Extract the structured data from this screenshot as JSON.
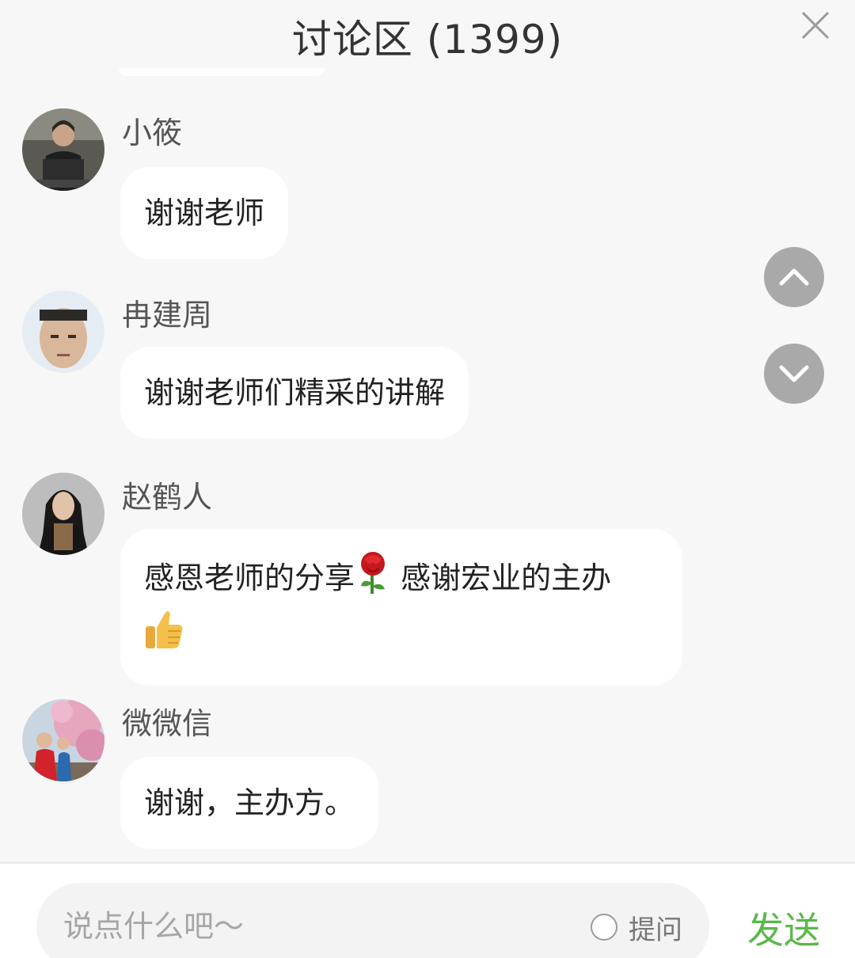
{
  "header": {
    "title": "讨论区 (1399)"
  },
  "messages": [
    {
      "name": "小筱",
      "text": "谢谢老师"
    },
    {
      "name": "冉建周",
      "text": "谢谢老师们精采的讲解"
    },
    {
      "name": "赵鹤人",
      "text_part1": "感恩老师的分享",
      "text_part2": "感谢宏业的主办",
      "emojis": [
        "rose-emoji",
        "thumbs-up-emoji"
      ]
    },
    {
      "name": "微微信",
      "text": "谢谢，主办方。"
    }
  ],
  "input": {
    "placeholder": "说点什么吧～",
    "ask_label": "提问",
    "send_label": "发送"
  },
  "colors": {
    "background": "#f7f7f7",
    "bubble": "#ffffff",
    "send": "#5bb84a",
    "scroll_button": "#a9a9a9"
  },
  "icons": {
    "close": "close-icon",
    "scroll_up": "chevron-up-icon",
    "scroll_down": "chevron-down-icon"
  }
}
